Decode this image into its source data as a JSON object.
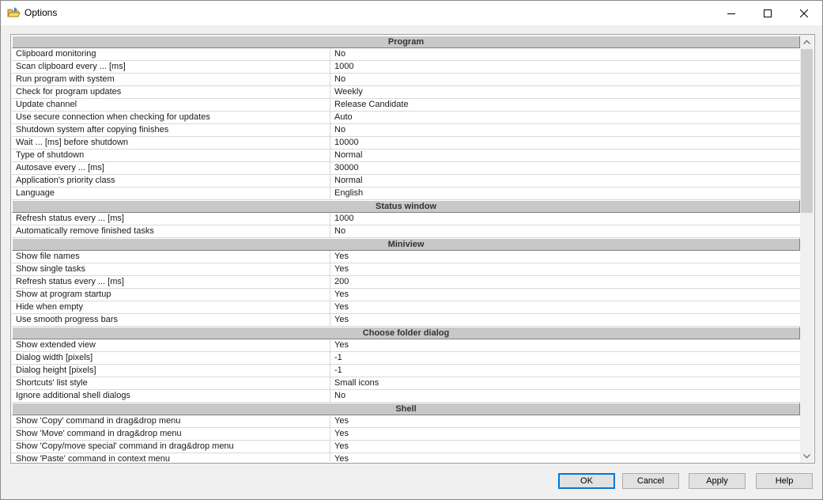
{
  "window": {
    "title": "Options",
    "minimize_icon": "minimize-icon",
    "maximize_icon": "maximize-icon",
    "close_icon": "close-icon"
  },
  "sections": [
    {
      "title": "Program",
      "rows": [
        {
          "name": "Clipboard monitoring",
          "value": "No"
        },
        {
          "name": "Scan clipboard every ... [ms]",
          "value": "1000"
        },
        {
          "name": "Run program with system",
          "value": "No"
        },
        {
          "name": "Check for program updates",
          "value": "Weekly"
        },
        {
          "name": "Update channel",
          "value": "Release Candidate"
        },
        {
          "name": "Use secure connection when checking for updates",
          "value": "Auto"
        },
        {
          "name": "Shutdown system after copying finishes",
          "value": "No"
        },
        {
          "name": "Wait ... [ms] before shutdown",
          "value": "10000"
        },
        {
          "name": "Type of shutdown",
          "value": "Normal"
        },
        {
          "name": "Autosave every ... [ms]",
          "value": "30000"
        },
        {
          "name": "Application's priority class",
          "value": "Normal"
        },
        {
          "name": "Language",
          "value": "English"
        }
      ]
    },
    {
      "title": "Status window",
      "rows": [
        {
          "name": "Refresh status every ... [ms]",
          "value": "1000"
        },
        {
          "name": "Automatically remove finished tasks",
          "value": "No"
        }
      ]
    },
    {
      "title": "Miniview",
      "rows": [
        {
          "name": "Show file names",
          "value": "Yes"
        },
        {
          "name": "Show single tasks",
          "value": "Yes"
        },
        {
          "name": "Refresh status every ... [ms]",
          "value": "200"
        },
        {
          "name": "Show at program startup",
          "value": "Yes"
        },
        {
          "name": "Hide when empty",
          "value": "Yes"
        },
        {
          "name": "Use smooth progress bars",
          "value": "Yes"
        }
      ]
    },
    {
      "title": "Choose folder dialog",
      "rows": [
        {
          "name": "Show extended view",
          "value": "Yes"
        },
        {
          "name": "Dialog width [pixels]",
          "value": "-1"
        },
        {
          "name": "Dialog height [pixels]",
          "value": "-1"
        },
        {
          "name": "Shortcuts' list style",
          "value": "Small icons"
        },
        {
          "name": "Ignore additional shell dialogs",
          "value": "No"
        }
      ]
    },
    {
      "title": "Shell",
      "rows": [
        {
          "name": "Show 'Copy' command in drag&drop menu",
          "value": "Yes"
        },
        {
          "name": "Show 'Move' command in drag&drop menu",
          "value": "Yes"
        },
        {
          "name": "Show 'Copy/move special' command in drag&drop menu",
          "value": "Yes"
        },
        {
          "name": "Show 'Paste' command in context menu",
          "value": "Yes"
        }
      ]
    }
  ],
  "buttons": {
    "ok": "OK",
    "cancel": "Cancel",
    "apply": "Apply",
    "help": "Help"
  },
  "colors": {
    "section_header_bg": "#c8c8c8",
    "ok_border": "#0078d7",
    "window_bg": "#f0f0f0"
  }
}
